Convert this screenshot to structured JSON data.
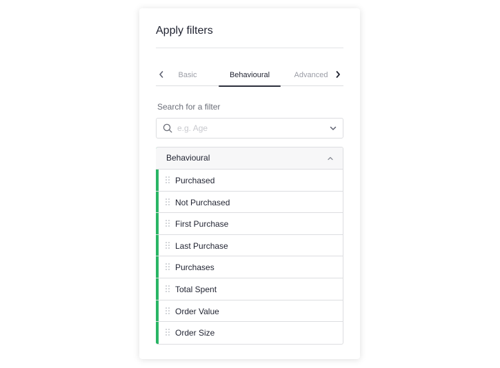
{
  "panel": {
    "title": "Apply filters"
  },
  "tabs": {
    "items": [
      {
        "label": "Basic",
        "active": false
      },
      {
        "label": "Behavioural",
        "active": true
      },
      {
        "label": "Advanced",
        "active": false
      }
    ]
  },
  "search": {
    "label": "Search for a filter",
    "placeholder": "e.g. Age",
    "value": ""
  },
  "filters": {
    "group_label": "Behavioural",
    "items": [
      "Purchased",
      "Not Purchased",
      "First Purchase",
      "Last Purchase",
      "Purchases",
      "Total Spent",
      "Order Value",
      "Order Size"
    ]
  },
  "colors": {
    "accent": "#29b565",
    "text": "#1f2230",
    "muted": "#9a9ca5",
    "border": "#dcdde0"
  },
  "icons": [
    "chevron-left-icon",
    "chevron-right-icon",
    "search-icon",
    "chevron-down-icon",
    "chevron-up-icon",
    "drag-handle-icon"
  ]
}
